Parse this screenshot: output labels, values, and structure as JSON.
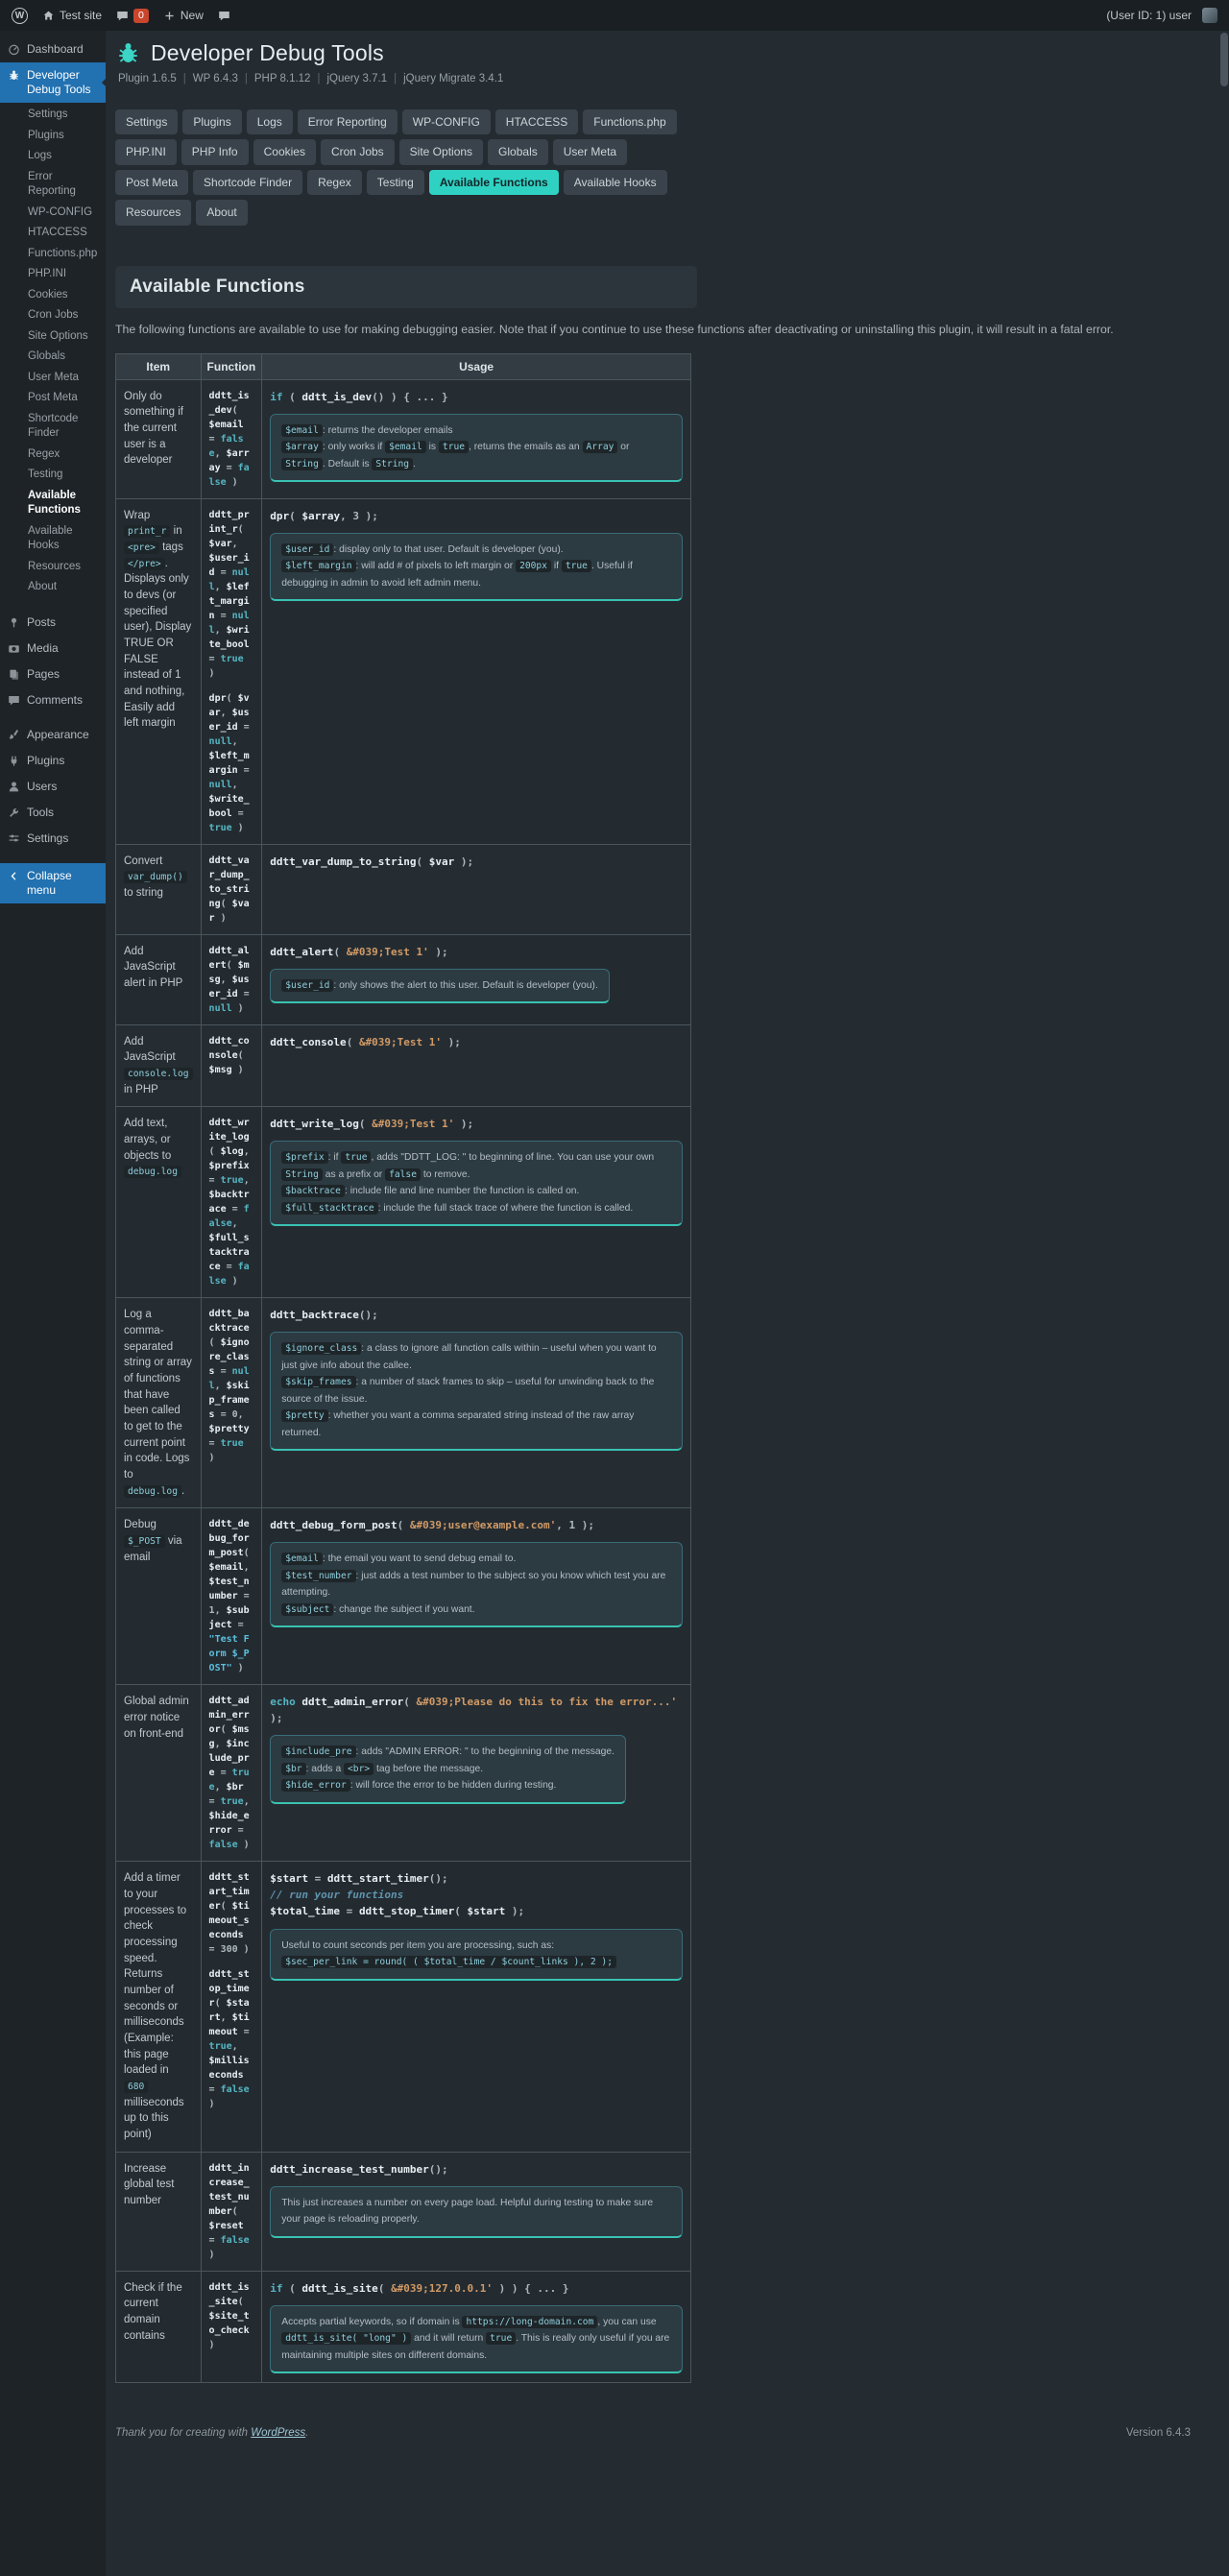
{
  "admin_bar": {
    "site_name": "Test site",
    "comments_count": "0",
    "new_label": "New",
    "user_info": "(User ID: 1) user"
  },
  "sidebar": {
    "dashboard": {
      "label": "Dashboard",
      "icon": "gauge-icon"
    },
    "plugin": {
      "label": "Developer Debug Tools",
      "icon": "bug-icon"
    },
    "plugin_submenu": [
      "Settings",
      "Plugins",
      "Logs",
      "Error Reporting",
      "WP-CONFIG",
      "HTACCESS",
      "Functions.php",
      "PHP.INI",
      "Cookies",
      "Cron Jobs",
      "Site Options",
      "Globals",
      "User Meta",
      "Post Meta",
      "Shortcode Finder",
      "Regex",
      "Testing",
      "Available Functions",
      "Available Hooks",
      "Resources",
      "About"
    ],
    "submenu_current": "Available Functions",
    "menu": [
      {
        "label": "Posts",
        "icon": "pin-icon"
      },
      {
        "label": "Media",
        "icon": "camera-icon"
      },
      {
        "label": "Pages",
        "icon": "pages-icon"
      },
      {
        "label": "Comments",
        "icon": "comment-bubble-icon"
      },
      {
        "label": "Appearance",
        "icon": "brush-icon",
        "group_start": true
      },
      {
        "label": "Plugins",
        "icon": "plug-icon"
      },
      {
        "label": "Users",
        "icon": "user-icon"
      },
      {
        "label": "Tools",
        "icon": "wrench-icon"
      },
      {
        "label": "Settings",
        "icon": "sliders-icon"
      }
    ],
    "collapse_label": "Collapse menu"
  },
  "header": {
    "title": "Developer Debug Tools",
    "separator": "|",
    "meta_parts": [
      "Plugin 1.6.5",
      "WP 6.4.3",
      "PHP 8.1.12",
      "jQuery 3.7.1",
      "jQuery Migrate 3.4.1"
    ]
  },
  "tabs": {
    "active": "Available Functions",
    "items": [
      "Settings",
      "Plugins",
      "Logs",
      "Error Reporting",
      "WP-CONFIG",
      "HTACCESS",
      "Functions.php",
      "PHP.INI",
      "PHP Info",
      "Cookies",
      "Cron Jobs",
      "Site Options",
      "Globals",
      "User Meta",
      "Post Meta",
      "Shortcode Finder",
      "Regex",
      "Testing",
      "Available Functions",
      "Available Hooks",
      "Resources",
      "About"
    ]
  },
  "page": {
    "heading": "Available Functions",
    "description": "The following functions are available to use for making debugging easier. Note that if you continue to use these functions after deactivating or uninstalling this plugin, it will result in a fatal error."
  },
  "table": {
    "headers": [
      "Item",
      "Function",
      "Usage"
    ],
    "rows": [
      {
        "item": "Only do something if the current user is a developer",
        "functions": [
          "ddtt_is_dev( $email = false, $array = false )"
        ],
        "usage": [
          {
            "code": [
              "if ( ddtt_is_dev() ) { ... }"
            ]
          },
          {
            "note": [
              "`$email`: returns the developer emails",
              "`$array`: only works if `$email` is `true`, returns the emails as an `Array` or `String`. Default is `String`."
            ]
          }
        ]
      },
      {
        "item": "Wrap `print_r` in `<pre>` tags `</pre>`. Displays only to devs (or specified user), Display TRUE OR FALSE instead of 1 and nothing, Easily add left margin",
        "functions": [
          "ddtt_print_r( $var, $user_id = null, $left_margin = null, $write_bool = true )",
          "dpr( $var, $user_id = null, $left_margin = null, $write_bool = true )"
        ],
        "usage": [
          {
            "code": [
              "dpr( $array, 3 );"
            ]
          },
          {
            "note": [
              "`$user_id`: display only to that user. Default is developer (you).",
              "`$left_margin`: will add # of pixels to left margin or `200px` if `true`. Useful if debugging in admin to avoid left admin menu."
            ]
          }
        ]
      },
      {
        "item": "Convert `var_dump()` to string",
        "functions": [
          "ddtt_var_dump_to_string( $var )"
        ],
        "usage": [
          {
            "code": [
              "ddtt_var_dump_to_string( $var );"
            ]
          }
        ]
      },
      {
        "item": "Add JavaScript alert in PHP",
        "functions": [
          "ddtt_alert( $msg, $user_id = null )"
        ],
        "usage": [
          {
            "code": [
              "ddtt_alert( &#039;Test 1' );"
            ]
          },
          {
            "note": [
              "`$user_id`: only shows the alert to this user. Default is developer (you)."
            ]
          }
        ]
      },
      {
        "item": "Add JavaScript `console.log` in PHP",
        "functions": [
          "ddtt_console( $msg )"
        ],
        "usage": [
          {
            "code": [
              "ddtt_console( &#039;Test 1' );"
            ]
          }
        ]
      },
      {
        "item": "Add text, arrays, or objects to `debug.log`",
        "functions": [
          "ddtt_write_log( $log, $prefix = true, $backtrace = false, $full_stacktrace = false )"
        ],
        "usage": [
          {
            "code": [
              "ddtt_write_log( &#039;Test 1' );"
            ]
          },
          {
            "note": [
              "`$prefix`: if `true`, adds \"DDTT_LOG: \" to beginning of line. You can use your own `String` as a prefix or `false` to remove.",
              "`$backtrace`: include file and line number the function is called on.",
              "`$full_stacktrace`: include the full stack trace of where the function is called."
            ]
          }
        ]
      },
      {
        "item": "Log a comma-separated string or array of functions that have been called to get to the current point in code. Logs to `debug.log`.",
        "functions": [
          "ddtt_backtrace( $ignore_class = null, $skip_frames = 0, $pretty = true )"
        ],
        "usage": [
          {
            "code": [
              "ddtt_backtrace();"
            ]
          },
          {
            "note": [
              "`$ignore_class`: a class to ignore all function calls within – useful when you want to just give info about the callee.",
              "`$skip_frames`: a number of stack frames to skip – useful for unwinding back to the source of the issue.",
              "`$pretty`: whether you want a comma separated string instead of the raw array returned."
            ]
          }
        ]
      },
      {
        "item": "Debug `$_POST` via email",
        "functions": [
          "ddtt_debug_form_post( $email, $test_number = 1, $subject = \"Test Form $_POST\" )"
        ],
        "usage": [
          {
            "code": [
              "ddtt_debug_form_post( &#039;user@example.com', 1 );"
            ]
          },
          {
            "note": [
              "`$email`: the email you want to send debug email to.",
              "`$test_number`: just adds a test number to the subject so you know which test you are attempting.",
              "`$subject`: change the subject if you want."
            ]
          }
        ]
      },
      {
        "item": "Global admin error notice on front-end",
        "functions": [
          "ddtt_admin_error( $msg, $include_pre = true, $br = true, $hide_error = false )"
        ],
        "usage": [
          {
            "code": [
              "echo ddtt_admin_error( &#039;Please do this to fix the error...' );"
            ]
          },
          {
            "note": [
              "`$include_pre`: adds \"ADMIN ERROR: \" to the beginning of the message.",
              "`$br`: adds a `<br>` tag before the message.",
              "`$hide_error`: will force the error to be hidden during testing."
            ]
          }
        ]
      },
      {
        "item": "Add a timer to your processes to check processing speed. Returns number of seconds or milliseconds (Example: this page loaded in `680` milliseconds up to this point)",
        "functions": [
          "ddtt_start_timer( $timeout_seconds = 300 )",
          "ddtt_stop_timer( $start, $timeout = true, $milliseconds = false )"
        ],
        "usage": [
          {
            "code": [
              "$start = ddtt_start_timer();",
              "// run your functions",
              "$total_time = ddtt_stop_timer( $start );"
            ]
          },
          {
            "note": [
              "Useful to count seconds per item you are processing, such as: `$sec_per_link = round( ( $total_time / $count_links ), 2 );`"
            ]
          }
        ]
      },
      {
        "item": "Increase global test number",
        "functions": [
          "ddtt_increase_test_number( $reset = false )"
        ],
        "usage": [
          {
            "code": [
              "ddtt_increase_test_number();"
            ]
          },
          {
            "note": [
              "This just increases a number on every page load. Helpful during testing to make sure your page is reloading properly."
            ]
          }
        ]
      },
      {
        "item": "Check if the current domain contains",
        "functions": [
          "ddtt_is_site( $site_to_check )"
        ],
        "usage": [
          {
            "code": [
              "if ( ddtt_is_site( &#039;127.0.0.1' ) ) { ... }"
            ]
          },
          {
            "note": [
              "Accepts partial keywords, so if domain is `https://long-domain.com`, you can use `ddtt_is_site( \"long\" )` and it will return `true`. This is really only useful if you are maintaining multiple sites on different domains."
            ]
          }
        ]
      }
    ]
  },
  "footer": {
    "thanks_prefix": "Thank you for creating with ",
    "link_label": "WordPress",
    "thanks_suffix": ".",
    "version": "Version 6.4.3"
  },
  "colors": {
    "accent_teal": "#2fd2c2",
    "active_blue": "#2271b1",
    "badge_red": "#c9462c"
  }
}
